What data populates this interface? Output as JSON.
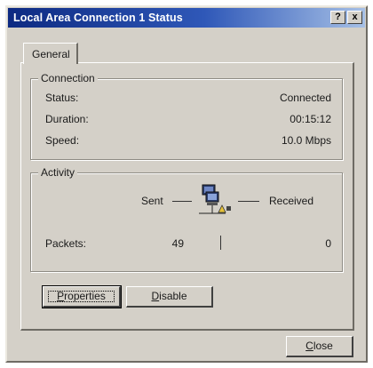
{
  "window": {
    "title": "Local Area Connection 1 Status",
    "help_glyph": "?",
    "close_glyph": "x"
  },
  "tabs": [
    {
      "label": "General"
    }
  ],
  "connection": {
    "group_title": "Connection",
    "rows": [
      {
        "label": "Status:",
        "value": "Connected"
      },
      {
        "label": "Duration:",
        "value": "00:15:12"
      },
      {
        "label": "Speed:",
        "value": "10.0 Mbps"
      }
    ]
  },
  "activity": {
    "group_title": "Activity",
    "sent_label": "Sent",
    "received_label": "Received",
    "packets_label": "Packets:",
    "packets_sent": "49",
    "packets_received": "0",
    "icon": "network-computers-icon"
  },
  "buttons": {
    "properties_prefix": "",
    "properties_mnemonic": "P",
    "properties_rest": "roperties",
    "disable_mnemonic": "D",
    "disable_rest": "isable",
    "close_mnemonic": "C",
    "close_rest": "lose"
  },
  "colors": {
    "titlebar_start": "#0d2a82",
    "titlebar_end": "#a6c0e6",
    "face": "#d4d0c8"
  }
}
